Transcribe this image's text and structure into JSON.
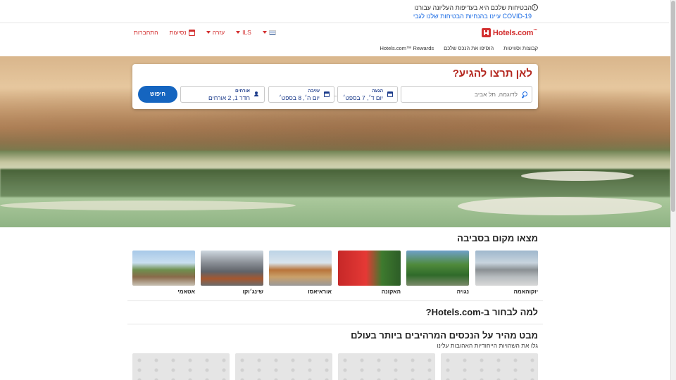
{
  "notice": {
    "title": "הבטיחות שלכם היא בעדיפות העליונה עבורנו",
    "link": "עיינו בהנחיות הבטיחות שלנו לגבי COVID-19",
    "icon": "info-icon"
  },
  "header": {
    "logo_text": "Hotels.com",
    "logo_tm": "™",
    "nav": {
      "currency": "ILS",
      "help": "עזרה",
      "trips": "נסיעות",
      "signin": "התחברות"
    },
    "subnav": [
      "קבוצות וסוויטות",
      "הוסיפו את הנכס שלכם",
      "Hotels.com™ Rewards"
    ]
  },
  "search": {
    "title": "לאן תרצו להגיע?",
    "destination_placeholder": "לדוגמה, תל אביב",
    "checkin_label": "הגעה",
    "checkin_value": "יום ד׳, 7 בספט׳",
    "checkout_label": "עזיבה",
    "checkout_value": "יום ה׳, 8 בספט׳",
    "guests_label": "אורחים",
    "guests_value": "חדר 1, 2 אורחים",
    "button": "חיפוש"
  },
  "nearby": {
    "title": "מצאו מקום בסביבה",
    "places": [
      "יוקוהאמה",
      "נגויה",
      "האקונה",
      "אוראיאסו",
      "שינג׳וקו",
      "אטאמי"
    ]
  },
  "why": {
    "title": "למה לבחור ב-Hotels.com?"
  },
  "deals": {
    "title": "מבט מהיר על הנכסים המרהיבים ביותר בעולם",
    "subtitle": "גלו את השהויות הייחודיות האהובות עלינו"
  },
  "colors": {
    "brand": "#d32f2f",
    "title_red": "#b3261e",
    "primary_blue": "#1565c0"
  }
}
